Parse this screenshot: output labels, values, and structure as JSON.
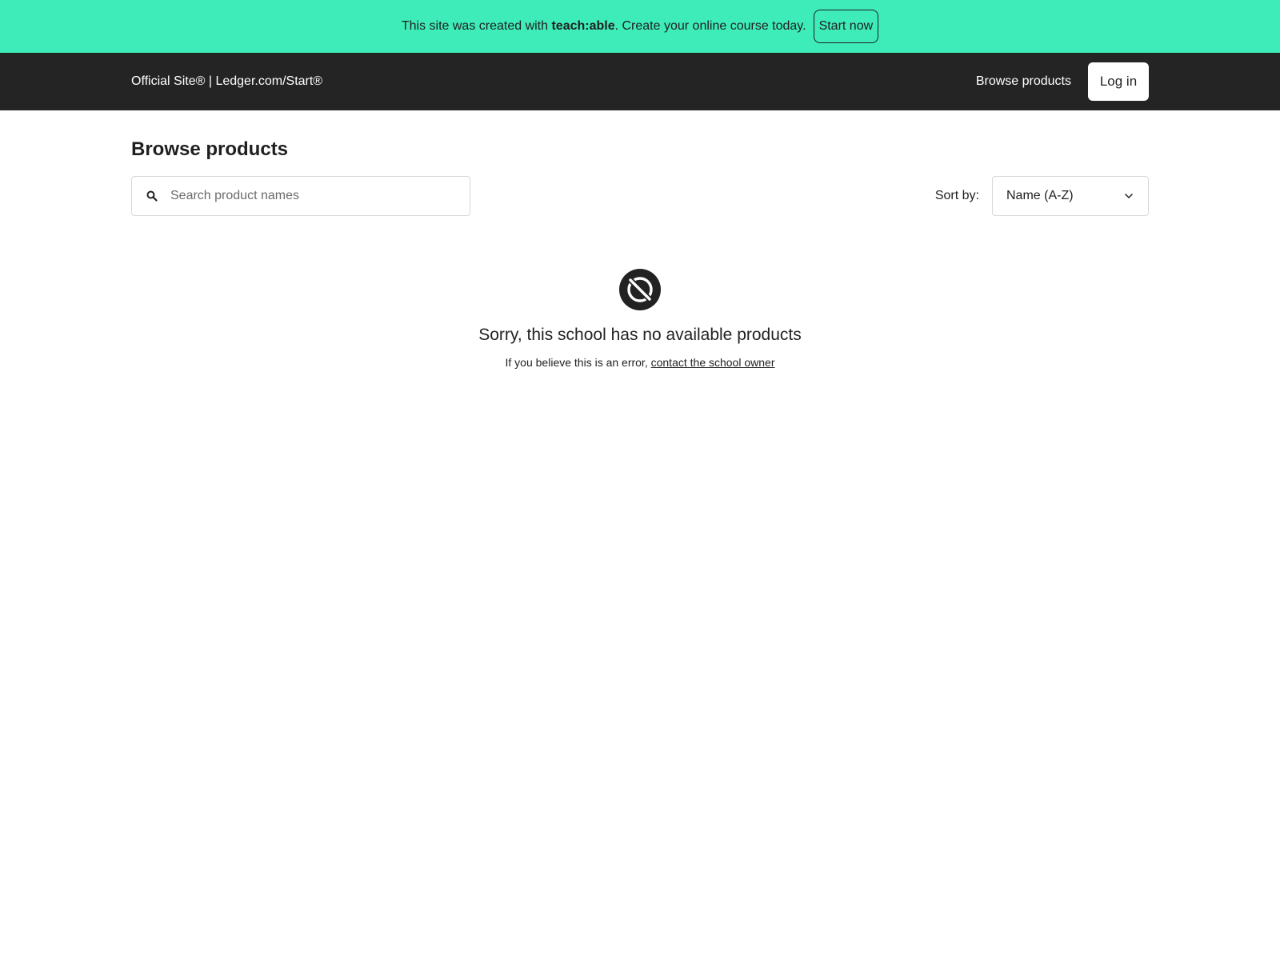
{
  "promo": {
    "text_before": "This site was created with ",
    "brand": "teach:able",
    "text_after": ". Create your online course today.",
    "cta": "Start now",
    "bg_color": "#3eecb9"
  },
  "topnav": {
    "site_name": "Official Site® | Ledger.com/Start®",
    "browse_link": "Browse products",
    "login_label": "Log in",
    "bg_color": "#242424"
  },
  "main": {
    "title": "Browse products",
    "search": {
      "placeholder": "Search product names",
      "value": "",
      "icon": "search-icon"
    },
    "sort": {
      "label": "Sort by:",
      "selected": "Name (A-Z)",
      "icon": "chevron-down-icon"
    }
  },
  "empty_state": {
    "icon": "no-products-icon",
    "title": "Sorry, this school has no available products",
    "sub_prefix": "If you believe this is an error, ",
    "sub_link": "contact the school owner"
  }
}
